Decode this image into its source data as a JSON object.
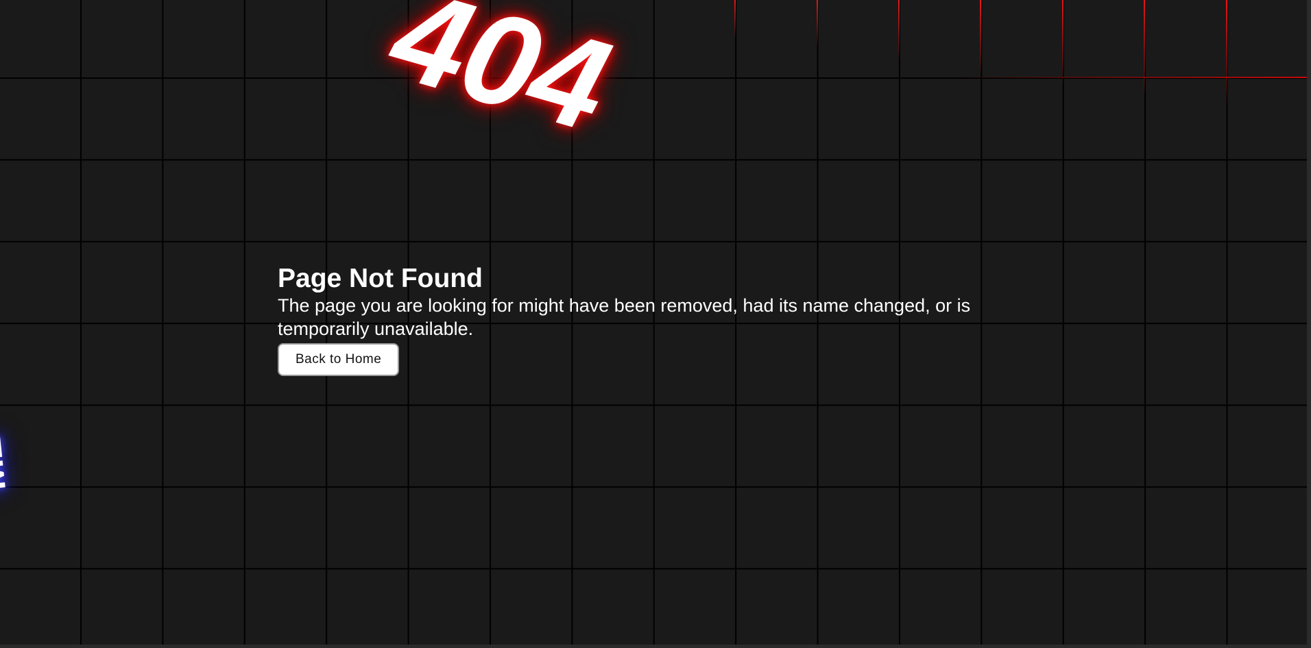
{
  "hero": {
    "code": "404",
    "side_text": "LM"
  },
  "message": {
    "title": "Page Not Found",
    "description": "The page you are looking for might have been removed, had its name changed, or is temporarily unavailable."
  },
  "actions": {
    "back_home_label": "Back to Home"
  },
  "colors": {
    "background": "#1a1a1a",
    "grid_line": "#000000",
    "accent_glow": "#ff1a1a",
    "side_glow": "#2a2aff",
    "button_bg": "#ffffff"
  }
}
